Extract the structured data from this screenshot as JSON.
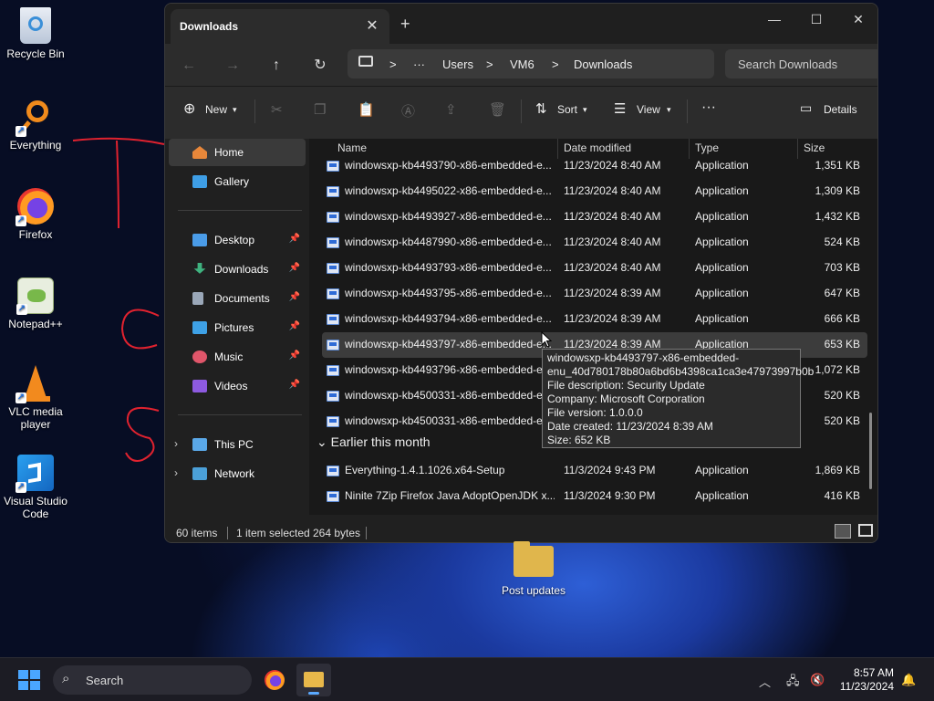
{
  "desktop": {
    "icons": [
      {
        "label": "Recycle Bin"
      },
      {
        "label": "Everything"
      },
      {
        "label": "Firefox"
      },
      {
        "label": "Notepad++"
      },
      {
        "label": "VLC media player"
      },
      {
        "label": "Visual Studio Code"
      }
    ],
    "folder": {
      "label": "Post updates"
    }
  },
  "window": {
    "tab_title": "Downloads",
    "tab_close": "✕",
    "new_tab": "+",
    "controls": {
      "minimize": "—",
      "maximize": "☐",
      "close": "✕"
    }
  },
  "address": {
    "more": "···",
    "path": [
      "Users",
      "VM6",
      "Downloads"
    ],
    "separator": ">",
    "search_placeholder": "Search Downloads"
  },
  "toolbar": {
    "new_label": "New",
    "sort_label": "Sort",
    "view_label": "View",
    "more_label": "···",
    "details_label": "Details"
  },
  "nav": {
    "home": "Home",
    "gallery": "Gallery",
    "quick": [
      {
        "label": "Desktop",
        "color": "#4a9ce8"
      },
      {
        "label": "Downloads",
        "color": "#3fb27f"
      },
      {
        "label": "Documents",
        "color": "#9aa7b8"
      },
      {
        "label": "Pictures",
        "color": "#3ea1e6"
      },
      {
        "label": "Music",
        "color": "#e0566a"
      },
      {
        "label": "Videos",
        "color": "#8d5ae0"
      }
    ],
    "this_pc": "This PC",
    "network": "Network"
  },
  "columns": {
    "name": "Name",
    "date": "Date modified",
    "type": "Type",
    "size": "Size"
  },
  "files": [
    {
      "name": "windowsxp-kb4493790-x86-embedded-e...",
      "date": "11/23/2024 8:40 AM",
      "type": "Application",
      "size": "1,351 KB"
    },
    {
      "name": "windowsxp-kb4495022-x86-embedded-e...",
      "date": "11/23/2024 8:40 AM",
      "type": "Application",
      "size": "1,309 KB"
    },
    {
      "name": "windowsxp-kb4493927-x86-embedded-e...",
      "date": "11/23/2024 8:40 AM",
      "type": "Application",
      "size": "1,432 KB"
    },
    {
      "name": "windowsxp-kb4487990-x86-embedded-e...",
      "date": "11/23/2024 8:40 AM",
      "type": "Application",
      "size": "524 KB"
    },
    {
      "name": "windowsxp-kb4493793-x86-embedded-e...",
      "date": "11/23/2024 8:40 AM",
      "type": "Application",
      "size": "703 KB"
    },
    {
      "name": "windowsxp-kb4493795-x86-embedded-e...",
      "date": "11/23/2024 8:39 AM",
      "type": "Application",
      "size": "647 KB"
    },
    {
      "name": "windowsxp-kb4493794-x86-embedded-e...",
      "date": "11/23/2024 8:39 AM",
      "type": "Application",
      "size": "666 KB"
    },
    {
      "name": "windowsxp-kb4493797-x86-embedded-e...",
      "date": "11/23/2024 8:39 AM",
      "type": "Application",
      "size": "653 KB"
    },
    {
      "name": "windowsxp-kb4493796-x86-embedded-e...",
      "date": "",
      "type": "",
      "size": "1,072 KB"
    },
    {
      "name": "windowsxp-kb4500331-x86-embedded-e...",
      "date": "",
      "type": "",
      "size": "520 KB"
    },
    {
      "name": "windowsxp-kb4500331-x86-embedded-e...",
      "date": "",
      "type": "",
      "size": "520 KB"
    }
  ],
  "group": {
    "label": "Earlier this month"
  },
  "group_files": [
    {
      "name": "Everything-1.4.1.1026.x64-Setup",
      "date": "11/3/2024 9:43 PM",
      "type": "Application",
      "size": "1,869 KB"
    },
    {
      "name": "Ninite 7Zip Firefox Java AdoptOpenJDK x...",
      "date": "11/3/2024 9:30 PM",
      "type": "Application",
      "size": "416 KB"
    }
  ],
  "tooltip": {
    "lines": [
      "windowsxp-kb4493797-x86-embedded-",
      "enu_40d780178b80a6bd6b4398ca1ca3e47973997b0b",
      "File description: Security Update",
      "Company: Microsoft Corporation",
      "File version: 1.0.0.0",
      "Date created: 11/23/2024 8:39 AM",
      "Size: 652 KB"
    ]
  },
  "status": {
    "count": "60 items",
    "selected": "1 item selected",
    "size": "264 bytes"
  },
  "taskbar": {
    "search_label": "Search",
    "time": "8:57 AM",
    "date": "11/23/2024"
  }
}
